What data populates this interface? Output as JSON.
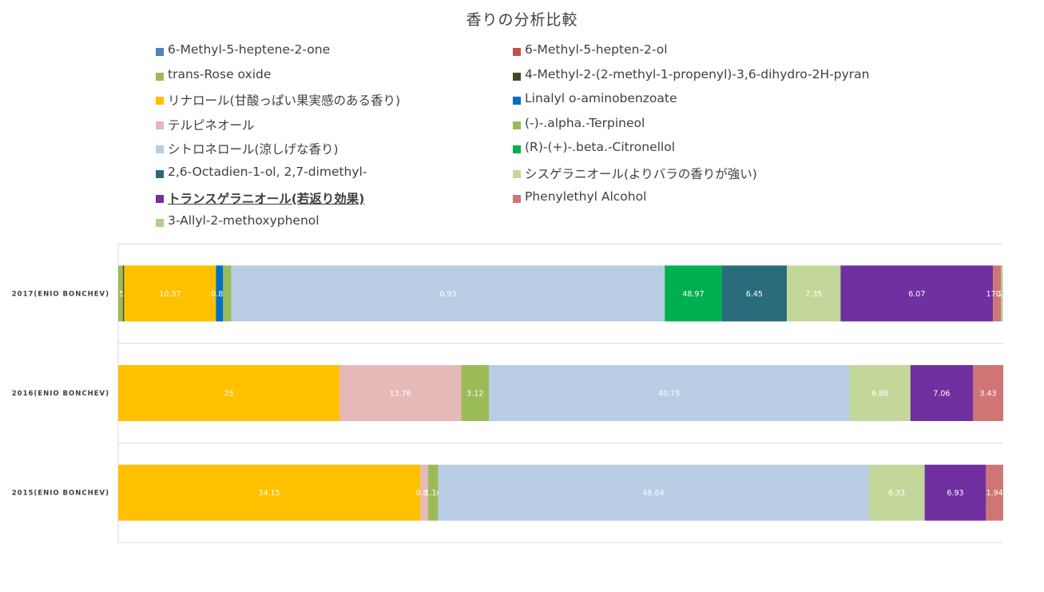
{
  "chart_data": {
    "type": "bar",
    "orientation": "horizontal",
    "stacked": true,
    "title": "香りの分析比較",
    "categories": [
      "2017(ENIO BONCHEV)",
      "2016(ENIO BONCHEV)",
      "2015(ENIO BONCHEV)"
    ],
    "xlim": [
      0,
      100
    ],
    "legend_position": "top",
    "grid": false,
    "series": [
      {
        "name": "6-Methyl-5-heptene-2-one",
        "color": "#4f81bd",
        "values": [
          null,
          null,
          null
        ]
      },
      {
        "name": "6-Methyl-5-hepten-2-ol",
        "color": "#c0504d",
        "values": [
          null,
          null,
          null
        ]
      },
      {
        "name": "trans-Rose oxide",
        "color": "#9bbb59",
        "values": [
          0.52,
          null,
          null
        ]
      },
      {
        "name": "4-Methyl-2-(2-methyl-1-propenyl)-3,6-dihydro-2H-pyran",
        "color": "#4a4528",
        "values": [
          0.15,
          null,
          null
        ]
      },
      {
        "name": "リナロール(甘酸っぱい果実感のある香り)",
        "color": "#ffc000",
        "values": [
          10.37,
          25,
          34.15
        ]
      },
      {
        "name": "Linalyl o-aminobenzoate",
        "color": "#0070c0",
        "values": [
          0.81,
          null,
          null
        ]
      },
      {
        "name": "テルピネオール",
        "color": "#e6b9b8",
        "values": [
          null,
          13.76,
          0.84
        ]
      },
      {
        "name": "(-)-.alpha.-Terpineol",
        "color": "#9bbb59",
        "values": [
          0.93,
          3.12,
          1.16
        ]
      },
      {
        "name": "シトロネロール(涼しげな香り)",
        "color": "#b9cde5",
        "values": [
          48.97,
          40.75,
          48.64
        ]
      },
      {
        "name": "(R)-(+)-.beta.-Citronellol",
        "color": "#00b050",
        "values": [
          6.45,
          null,
          null
        ]
      },
      {
        "name": "2,6-Octadien-1-ol, 2,7-dimethyl-",
        "color": "#2a6b7c",
        "values": [
          7.35,
          null,
          null
        ]
      },
      {
        "name": "シスゲラニオール(よりバラの香りが強い)",
        "color": "#c4d79b",
        "values": [
          6.07,
          6.88,
          6.33
        ]
      },
      {
        "name": "トランスゲラニオール(若返り効果)",
        "color": "#7030a0",
        "values": [
          17.23,
          7.06,
          6.93
        ]
      },
      {
        "name": "Phenylethyl Alcohol",
        "color": "#d07575",
        "values": [
          0.9,
          3.43,
          1.94
        ]
      },
      {
        "name": "3-Allyl-2-methoxyphenol",
        "color": "#a9d18e",
        "values": [
          0.2,
          null,
          null
        ]
      }
    ],
    "data_labels": [
      [
        "0.52",
        "",
        "10.37",
        "0.81",
        "",
        "0.93",
        "48.97",
        "6.45",
        "7.35",
        "6.07",
        "17.23",
        "0.9",
        ""
      ],
      [
        "25",
        "13.76",
        "3.12",
        "40.75",
        "6.88",
        "7.06",
        "3.43"
      ],
      [
        "34.15",
        "0.84",
        "1.16",
        "48.64",
        "6.33",
        "6.93",
        "1.94"
      ]
    ],
    "emphasized_legend_entry": "トランスゲラニオール(若返り効果)"
  }
}
